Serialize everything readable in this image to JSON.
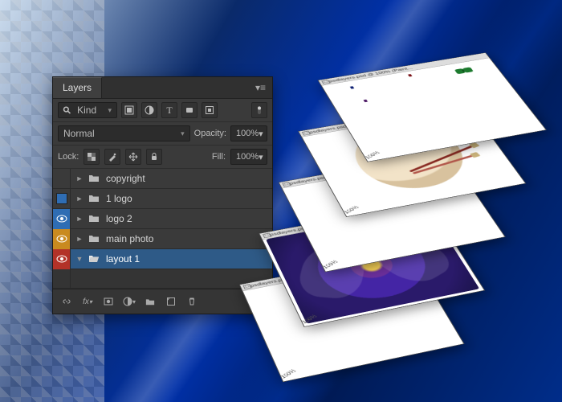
{
  "panel": {
    "title": "Layers",
    "filter": {
      "search_icon": "⚲",
      "kind_label": "Kind"
    },
    "filterIcons": [
      "pixel",
      "mask",
      "text",
      "shape",
      "smart"
    ],
    "blend": {
      "mode": "Normal",
      "opacity_label": "Opacity:",
      "opacity_value": "100%"
    },
    "lock": {
      "label": "Lock:",
      "fill_label": "Fill:",
      "fill_value": "100%"
    },
    "layers": [
      {
        "name": "copyright",
        "color": "none",
        "vis": "hidden",
        "expand": "►",
        "type": "folder"
      },
      {
        "name": "1 logo",
        "color": "blue",
        "vis": "hidden",
        "expand": "►",
        "type": "folder"
      },
      {
        "name": "logo 2",
        "color": "blue",
        "vis": "visible",
        "expand": "►",
        "type": "folder"
      },
      {
        "name": "main photo",
        "color": "orange",
        "vis": "visible",
        "expand": "►",
        "type": "folder"
      },
      {
        "name": "layout 1",
        "color": "red",
        "vis": "visible",
        "expand": "▼",
        "type": "folder",
        "selected": true
      }
    ],
    "footerIcons": [
      "link",
      "fx",
      "mask",
      "adjust",
      "group",
      "new",
      "trash"
    ]
  },
  "stack": {
    "docTitle": "psdlayers.psd @ 100% (Paint...",
    "docTitleShort": "psdlayers.psd @ 100",
    "zoom": "100%"
  }
}
